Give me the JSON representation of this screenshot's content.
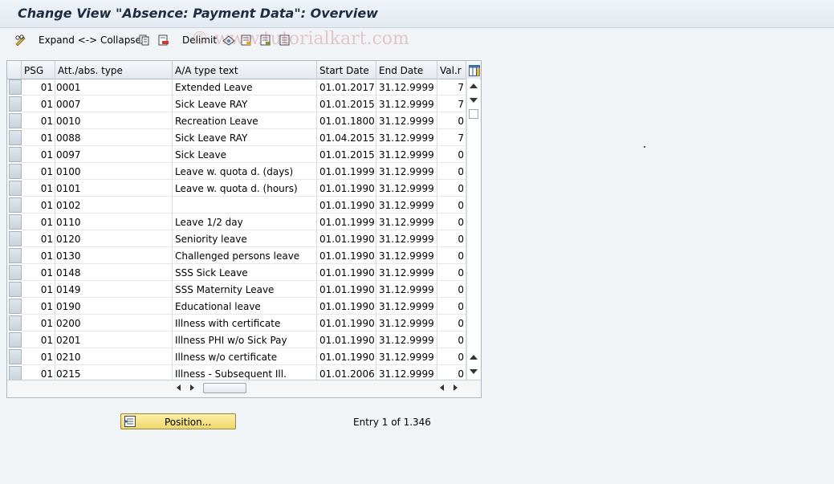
{
  "window": {
    "title": "Change View \"Absence: Payment Data\": Overview"
  },
  "toolbar": {
    "expand_collapse_label": "Expand <-> Collapse",
    "delimit_label": "Delimit"
  },
  "watermark": "© www.tutorialkart.com",
  "table": {
    "columns": [
      "PSG",
      "Att./abs. type",
      "A/A type text",
      "Start Date",
      "End Date",
      "Val.r"
    ],
    "rows": [
      [
        "01",
        "0001",
        "Extended Leave",
        "01.01.2017",
        "31.12.9999",
        "7"
      ],
      [
        "01",
        "0007",
        "Sick Leave RAY",
        "01.01.2015",
        "31.12.9999",
        "7"
      ],
      [
        "01",
        "0010",
        "Recreation Leave",
        "01.01.1800",
        "31.12.9999",
        "0"
      ],
      [
        "01",
        "0088",
        "Sick Leave RAY",
        "01.04.2015",
        "31.12.9999",
        "7"
      ],
      [
        "01",
        "0097",
        "Sick Leave",
        "01.01.2015",
        "31.12.9999",
        "0"
      ],
      [
        "01",
        "0100",
        "Leave w. quota d. (days)",
        "01.01.1999",
        "31.12.9999",
        "0"
      ],
      [
        "01",
        "0101",
        "Leave w. quota d. (hours)",
        "01.01.1990",
        "31.12.9999",
        "0"
      ],
      [
        "01",
        "0102",
        "",
        "01.01.1990",
        "31.12.9999",
        "0"
      ],
      [
        "01",
        "0110",
        "Leave 1/2 day",
        "01.01.1999",
        "31.12.9999",
        "0"
      ],
      [
        "01",
        "0120",
        "Seniority leave",
        "01.01.1990",
        "31.12.9999",
        "0"
      ],
      [
        "01",
        "0130",
        "Challenged persons leave",
        "01.01.1990",
        "31.12.9999",
        "0"
      ],
      [
        "01",
        "0148",
        "SSS Sick Leave",
        "01.01.1990",
        "31.12.9999",
        "0"
      ],
      [
        "01",
        "0149",
        "SSS Maternity Leave",
        "01.01.1990",
        "31.12.9999",
        "0"
      ],
      [
        "01",
        "0190",
        "Educational leave",
        "01.01.1990",
        "31.12.9999",
        "0"
      ],
      [
        "01",
        "0200",
        "Illness with certificate",
        "01.01.1990",
        "31.12.9999",
        "0"
      ],
      [
        "01",
        "0201",
        "Illness PHI w/o Sick Pay",
        "01.01.1990",
        "31.12.9999",
        "0"
      ],
      [
        "01",
        "0210",
        "Illness w/o certificate",
        "01.01.1990",
        "31.12.9999",
        "0"
      ],
      [
        "01",
        "0215",
        "Illness - Subsequent Ill.",
        "01.01.2006",
        "31.12.9999",
        "0"
      ]
    ]
  },
  "footer": {
    "position_label": "Position...",
    "entry_text": "Entry 1 of 1.346"
  },
  "icons": {
    "toolbar": [
      "pencil-glasses-icon",
      "copy-icon",
      "delete-icon",
      "print-icon",
      "select-all-icon",
      "deselect-icon",
      "config-icon"
    ],
    "column_config": "table-settings-icon"
  },
  "colors": {
    "position_button": "#f3dc7a",
    "title_text": "#1c2d3f"
  }
}
